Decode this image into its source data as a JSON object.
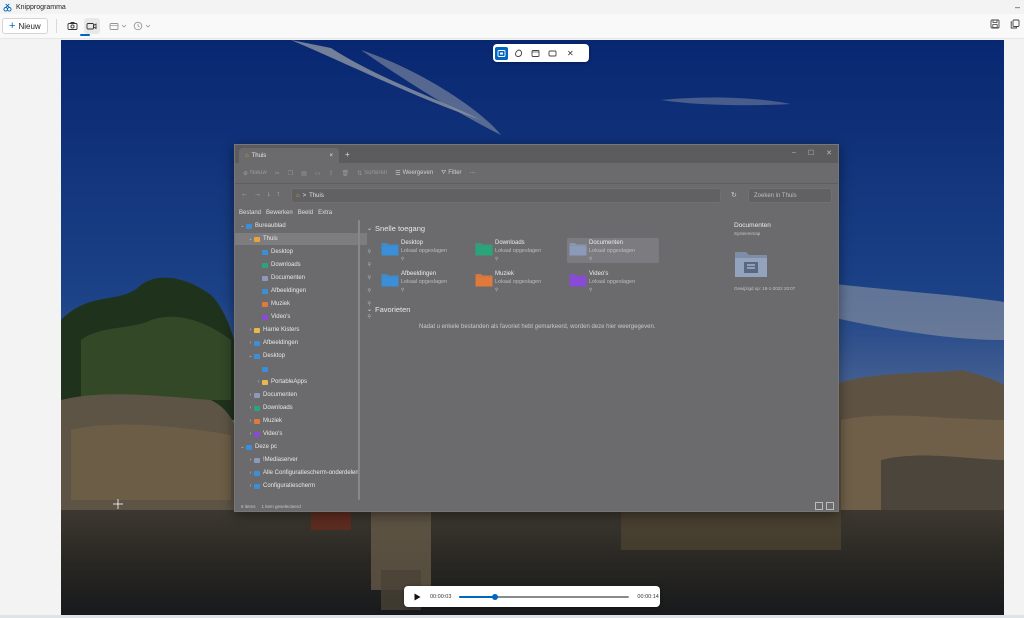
{
  "app": {
    "title": "Knipprogramma",
    "minimize_glyph": "–"
  },
  "toolbar": {
    "new_label": "Nieuw",
    "modes": [
      {
        "icon": "camera-icon",
        "active": false
      },
      {
        "icon": "video-camera-icon",
        "active": true
      }
    ],
    "shape_dropdown_icon": "rectangle-select-icon",
    "delay_dropdown_icon": "clock-icon",
    "right_icons": [
      "save-icon",
      "copy-icon"
    ]
  },
  "capture_bar": {
    "buttons": [
      "rectangle-mode-icon",
      "freeform-mode-icon",
      "window-mode-icon",
      "fullscreen-mode-icon"
    ],
    "close_glyph": "✕"
  },
  "explorer": {
    "tab_title": "Thuis",
    "tab_close": "×",
    "new_tab": "+",
    "window_controls": [
      "–",
      "☐",
      "✕"
    ],
    "command_bar": {
      "new_label": "Nieuw",
      "sort_label": "Sorteren",
      "view_label": "Weergeven",
      "filter_label": "Filter",
      "more_label": "···"
    },
    "address": {
      "nav": [
        "←",
        "→",
        "↓",
        "↑"
      ],
      "path_separator": ">",
      "path": "Thuis",
      "refresh": "↻",
      "search_placeholder": "Zoeken in Thuis"
    },
    "menu": [
      "Bestand",
      "Bewerken",
      "Beeld",
      "Extra"
    ],
    "nav_tree": [
      {
        "label": "Bureaublad",
        "level": 0,
        "expanded": true,
        "color": "#3a8fd8"
      },
      {
        "label": "Thuis",
        "level": 1,
        "expanded": true,
        "selected": true,
        "color": "#e8a33a"
      },
      {
        "label": "Desktop",
        "level": 2,
        "pinned": true,
        "color": "#3a8fd8"
      },
      {
        "label": "Downloads",
        "level": 2,
        "pinned": true,
        "color": "#2aa57a"
      },
      {
        "label": "Documenten",
        "level": 2,
        "pinned": true,
        "color": "#8a9ab8"
      },
      {
        "label": "Afbeeldingen",
        "level": 2,
        "pinned": true,
        "color": "#3a8fd8"
      },
      {
        "label": "Muziek",
        "level": 2,
        "pinned": true,
        "color": "#e07a3a"
      },
      {
        "label": "Video's",
        "level": 2,
        "pinned": true,
        "color": "#8a4ad8"
      },
      {
        "label": "Harrie Kisters",
        "level": 1,
        "expanded": false,
        "color": "#e8b84a"
      },
      {
        "label": "Afbeeldingen",
        "level": 1,
        "expanded": false,
        "color": "#3a8fd8"
      },
      {
        "label": "Desktop",
        "level": 1,
        "expanded": true,
        "color": "#3a8fd8"
      },
      {
        "label": "",
        "level": 2,
        "color": "#3a8fd8"
      },
      {
        "label": "PortableApps",
        "level": 2,
        "expanded": false,
        "color": "#e8b84a"
      },
      {
        "label": "Documenten",
        "level": 1,
        "expanded": false,
        "color": "#8a9ab8"
      },
      {
        "label": "Downloads",
        "level": 1,
        "expanded": false,
        "color": "#2aa57a"
      },
      {
        "label": "Muziek",
        "level": 1,
        "expanded": false,
        "color": "#e07a3a"
      },
      {
        "label": "Video's",
        "level": 1,
        "expanded": false,
        "color": "#8a4ad8"
      },
      {
        "label": "Deze pc",
        "level": 0,
        "expanded": true,
        "color": "#3a8fd8"
      },
      {
        "label": "!Mediaserver",
        "level": 1,
        "expanded": false,
        "color": "#8a9ab8"
      },
      {
        "label": "Alle Configuratiescherm-onderdelen",
        "level": 1,
        "expanded": false,
        "color": "#3a8fd8"
      },
      {
        "label": "Configuratiescherm",
        "level": 1,
        "expanded": false,
        "color": "#3a8fd8"
      }
    ],
    "quick_access": {
      "heading": "Snelle toegang",
      "tiles": [
        {
          "name": "Desktop",
          "sub": "Lokaal opgeslagen",
          "icon": "desktop-folder-icon",
          "color": "#3a8fd8",
          "selected": false
        },
        {
          "name": "Downloads",
          "sub": "Lokaal opgeslagen",
          "icon": "downloads-folder-icon",
          "color": "#2aa57a",
          "selected": false
        },
        {
          "name": "Documenten",
          "sub": "Lokaal opgeslagen",
          "icon": "documents-folder-icon",
          "color": "#8a9ab8",
          "selected": true
        },
        {
          "name": "Afbeeldingen",
          "sub": "Lokaal opgeslagen",
          "icon": "pictures-folder-icon",
          "color": "#3a8fd8",
          "selected": false
        },
        {
          "name": "Muziek",
          "sub": "Lokaal opgeslagen",
          "icon": "music-folder-icon",
          "color": "#e07a3a",
          "selected": false
        },
        {
          "name": "Video's",
          "sub": "Lokaal opgeslagen",
          "icon": "videos-folder-icon",
          "color": "#8a4ad8",
          "selected": false
        }
      ]
    },
    "favorites": {
      "heading": "Favorieten",
      "empty_text": "Nadat u enkele bestanden als favoriet hebt gemarkeerd, worden deze hier weergegeven."
    },
    "preview": {
      "title": "Documenten",
      "subtitle": "Systeemmap",
      "modified": "Gewijzigd op:  18-1-2022 20:07"
    },
    "status": {
      "items": "6 items",
      "selected": "1 item geselecteerd"
    }
  },
  "player": {
    "current_time": "00:00:03",
    "total_time": "00:00:14",
    "progress": 0.21
  },
  "colors": {
    "accent": "#0067c0"
  }
}
